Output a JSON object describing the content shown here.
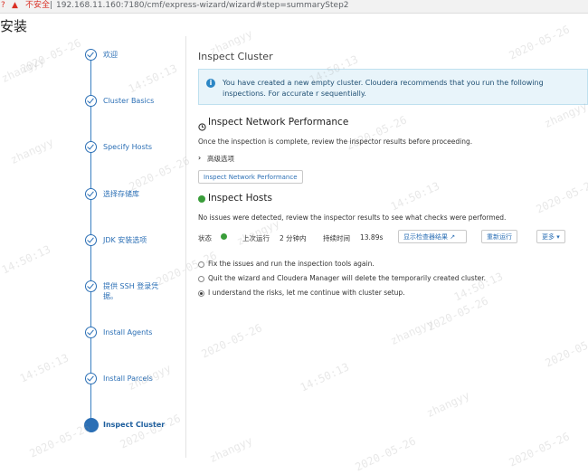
{
  "browser": {
    "warning_label": "不安全",
    "url": "192.168.11.160:7180/cmf/express-wizard/wizard#step=summaryStep2"
  },
  "page": {
    "heading_fragment": "安装"
  },
  "steps": [
    {
      "label": "欢迎"
    },
    {
      "label": "Cluster Basics"
    },
    {
      "label": "Specify Hosts"
    },
    {
      "label": "选择存储库"
    },
    {
      "label": "JDK 安装选项"
    },
    {
      "label": "提供 SSH 登录凭据。"
    },
    {
      "label": "Install Agents"
    },
    {
      "label": "Install Parcels"
    },
    {
      "label": "Inspect Cluster"
    }
  ],
  "main": {
    "title": "Inspect Cluster",
    "info_text": "You have created a new empty cluster. Cloudera recommends that you run the following inspections. For accurate r sequentially.",
    "network": {
      "heading": "Inspect Network Performance",
      "description": "Once the inspection is complete, review the inspector results before proceeding.",
      "advanced_label": "高级选项",
      "button": "Inspect Network Performance"
    },
    "hosts": {
      "heading": "Inspect Hosts",
      "description": "No issues were detected, review the inspector results to see what checks were performed.",
      "status_label": "状态",
      "last_run_label": "上次运行",
      "last_run_value": "2 分钟内",
      "duration_label": "持续时间",
      "duration_value": "13.89s",
      "show_results_button": "显示检查器结果",
      "rerun_button": "重新运行",
      "more_button": "更多"
    },
    "options": [
      {
        "label": "Fix the issues and run the inspection tools again.",
        "selected": false
      },
      {
        "label": "Quit the wizard and Cloudera Manager will delete the temporarily created cluster.",
        "selected": false
      },
      {
        "label": "I understand the risks, let me continue with cluster setup.",
        "selected": true
      }
    ]
  },
  "watermark": {
    "user": "zhangyy",
    "date": "2020-05-26",
    "time": "14:50:13"
  },
  "colors": {
    "accent": "#2b6fb5",
    "success": "#3a9d3a",
    "info_bg": "#e8f4fa"
  }
}
